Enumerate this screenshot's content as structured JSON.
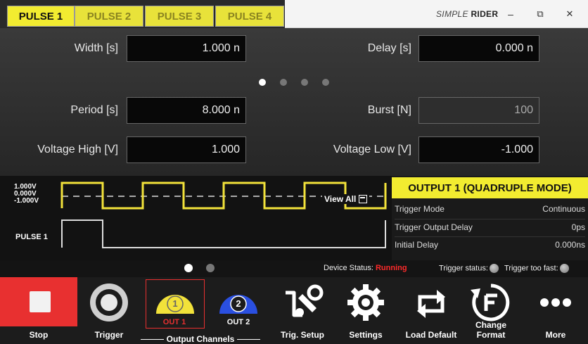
{
  "tabs": [
    {
      "label": "PULSE 1",
      "active": true
    },
    {
      "label": "PULSE 2",
      "active": false
    },
    {
      "label": "PULSE 3",
      "active": false
    },
    {
      "label": "PULSE 4",
      "active": false
    }
  ],
  "brand": {
    "prefix": "SIMPLE",
    "name": "RIDER"
  },
  "window_controls": {
    "minimize": "–",
    "restore": "⧉",
    "close": "✕"
  },
  "params": {
    "width": {
      "label": "Width [s]",
      "value": "1.000 n"
    },
    "delay": {
      "label": "Delay [s]",
      "value": "0.000 n"
    },
    "period": {
      "label": "Period [s]",
      "value": "8.000 n"
    },
    "burst": {
      "label": "Burst [N]",
      "value": "100"
    },
    "voltage_high": {
      "label": "Voltage High [V]",
      "value": "1.000"
    },
    "voltage_low": {
      "label": "Voltage Low [V]",
      "value": "-1.000"
    }
  },
  "param_pager": {
    "pages": 4,
    "active": 0
  },
  "waveform": {
    "v_high": "1.000V",
    "v_zero": "0.000V",
    "v_low": "-1.000V",
    "pulse_label": "PULSE 1",
    "view_all": "View All"
  },
  "output_panel": {
    "title": "OUTPUT 1 (QUADRUPLE MODE)",
    "rows": [
      {
        "key": "Trigger Mode",
        "value": "Continuous"
      },
      {
        "key": "Trigger Output Delay",
        "value": "0ps"
      },
      {
        "key": "Initial Delay",
        "value": "0.000ns"
      }
    ]
  },
  "status": {
    "pager": {
      "pages": 2,
      "active": 0
    },
    "device_status_label": "Device Status:",
    "device_status_value": "Running",
    "trigger_status_label": "Trigger status:",
    "trigger_too_fast_label": "Trigger too fast:"
  },
  "toolbar": {
    "stop": "Stop",
    "trigger": "Trigger",
    "out1": {
      "number": "1",
      "label": "OUT 1"
    },
    "out2": {
      "number": "2",
      "label": "OUT 2"
    },
    "output_channels": "Output Channels",
    "trig_setup": "Trig. Setup",
    "settings": "Settings",
    "load_default": "Load Default",
    "change_format": "Change Format",
    "more": "More"
  },
  "colors": {
    "accent_yellow": "#f2ec30",
    "stop_red": "#e83030",
    "out1_yellow": "#f2e23a",
    "out2_blue": "#2a4fe0",
    "running_red": "#ff2a2a"
  }
}
